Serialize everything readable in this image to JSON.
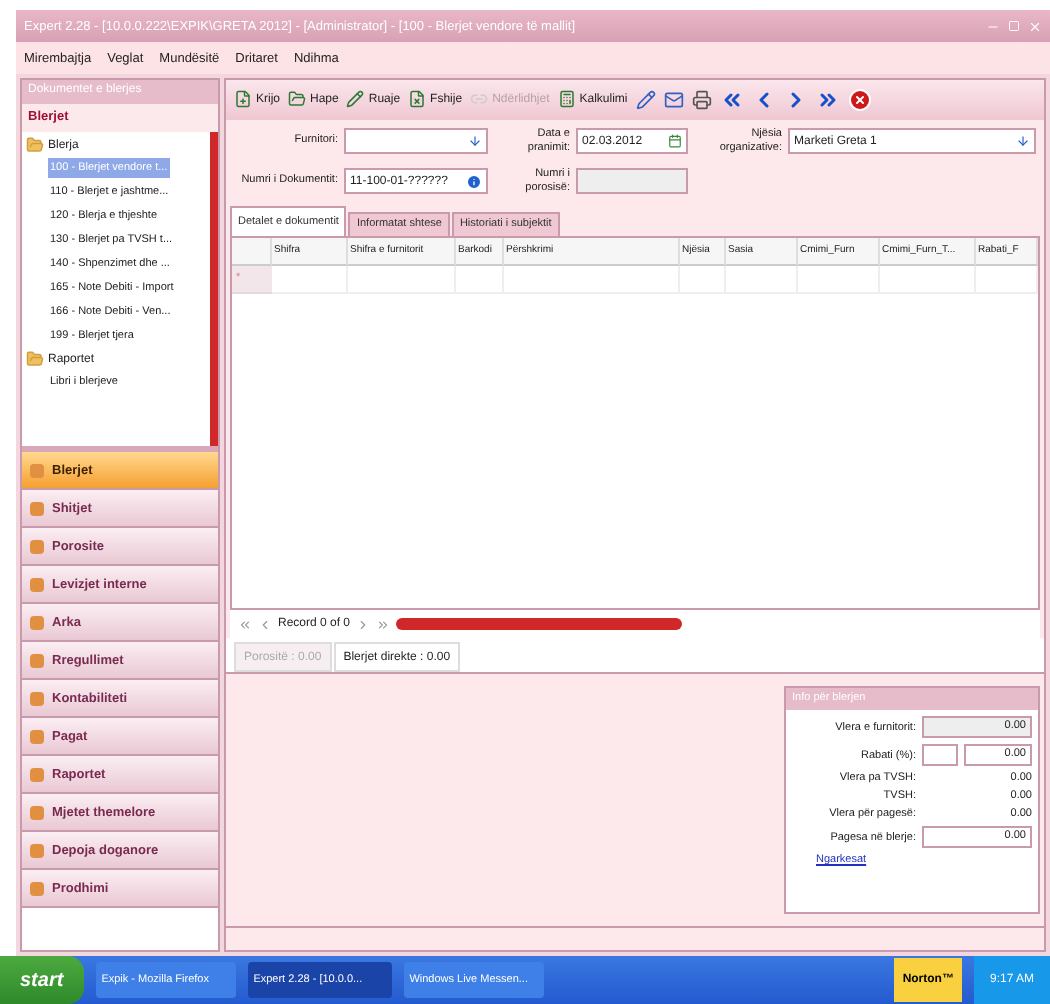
{
  "window": {
    "title": "Expert 2.28 - [10.0.0.222\\EXPIK\\GRETA 2012] - [Administrator] - [100 - Blerjet vendore të mallit]"
  },
  "menu": [
    "Mirembajtja",
    "Veglat",
    "Mundësitë",
    "Dritaret",
    "Ndihma"
  ],
  "sidebar": {
    "header": "Dokumentet e blerjes",
    "section": "Blerjet",
    "tree": [
      {
        "label": "Blerja",
        "expanded": true,
        "children": [
          {
            "label": "100 - Blerjet vendore t...",
            "selected": true
          },
          {
            "label": "110 - Blerjet e jashtme...",
            "selected": false
          },
          {
            "label": "120 - Blerja e thjeshte",
            "selected": false
          },
          {
            "label": "130 - Blerjet pa TVSH t...",
            "selected": false
          },
          {
            "label": "140 - Shpenzimet dhe ...",
            "selected": false
          },
          {
            "label": "165 - Note Debiti - Import",
            "selected": false
          },
          {
            "label": "166 - Note Debiti - Ven...",
            "selected": false
          },
          {
            "label": "199 - Blerjet tjera",
            "selected": false
          }
        ]
      },
      {
        "label": "Raportet",
        "expanded": true,
        "children": [
          {
            "label": "Libri i blerjeve",
            "selected": false
          }
        ]
      }
    ],
    "nav": [
      {
        "label": "Blerjet",
        "selected": true
      },
      {
        "label": "Shitjet",
        "selected": false
      },
      {
        "label": "Porosite",
        "selected": false
      },
      {
        "label": "Levizjet interne",
        "selected": false
      },
      {
        "label": "Arka",
        "selected": false
      },
      {
        "label": "Rregullimet",
        "selected": false
      },
      {
        "label": "Kontabiliteti",
        "selected": false
      },
      {
        "label": "Pagat",
        "selected": false
      },
      {
        "label": "Raportet",
        "selected": false
      },
      {
        "label": "Mjetet themelore",
        "selected": false
      },
      {
        "label": "Depoja doganore",
        "selected": false
      },
      {
        "label": "Prodhimi",
        "selected": false
      }
    ]
  },
  "toolbar": [
    {
      "kind": "new",
      "label": "Krijo",
      "disabled": false
    },
    {
      "kind": "open",
      "label": "Hape",
      "disabled": false
    },
    {
      "kind": "save",
      "label": "Ruaje",
      "disabled": false
    },
    {
      "kind": "delete",
      "label": "Fshije",
      "disabled": false
    },
    {
      "kind": "link",
      "label": "Ndërlidhjet",
      "disabled": true
    },
    {
      "kind": "calc",
      "label": "Kalkulimi",
      "disabled": false
    }
  ],
  "form": {
    "supplier": {
      "label": "Furnitori:"
    },
    "date": {
      "label": "Data e pranimit:",
      "value": "02.03.2012"
    },
    "unit": {
      "label": "Njësia organizative:",
      "value": "Marketi Greta 1"
    },
    "doc_number": {
      "label": "Numri i Dokumentit:",
      "value": "11-100-01-??????"
    },
    "order_number": {
      "label": "Numri i porosisë:",
      "disabled": true
    }
  },
  "tabs": [
    {
      "label": "Detalet e dokumentit",
      "selected": true
    },
    {
      "label": "Informatat shtese",
      "selected": false
    },
    {
      "label": "Historiati i subjektit",
      "selected": false
    }
  ],
  "table": {
    "columns": [
      "Shifra",
      "Shifra e furnitorit",
      "Barkodi",
      "Përshkrimi",
      "Njësia",
      "Sasia",
      "Cmimi_Furn",
      "Cmimi_Furn_T...",
      "Rabati_F"
    ],
    "new_row_marker": "*"
  },
  "pager": {
    "text": "Record 0 of 0"
  },
  "bottom_tabs": [
    {
      "label": "Porositë : 0.00",
      "selected": false
    },
    {
      "label": "Blerjet direkte : 0.00",
      "selected": true
    }
  ],
  "info": {
    "title": "Info për blerjen",
    "rows": [
      {
        "kind": "readonly",
        "label": "Vlera e furnitorit:",
        "value": "0.00"
      },
      {
        "kind": "discount",
        "label": "Rabati (%):",
        "value": "0.00"
      },
      {
        "kind": "text",
        "label": "Vlera pa TVSH:",
        "value": "0.00"
      },
      {
        "kind": "text",
        "label": "TVSH:",
        "value": "0.00"
      },
      {
        "kind": "text",
        "label": "Vlera për pagesë:",
        "value": "0.00"
      },
      {
        "kind": "input",
        "label": "Pagesa në blerje:",
        "value": "0.00"
      }
    ],
    "link": "Ngarkesat"
  },
  "taskbar": {
    "start": "start",
    "items": [
      {
        "label": "Expik - Mozilla Firefox",
        "selected": false
      },
      {
        "label": "Expert 2.28 - [10.0.0...",
        "selected": true
      },
      {
        "label": "Windows Live Messen...",
        "selected": false
      }
    ],
    "norton": "Norton™",
    "clock": "9:17 AM"
  }
}
